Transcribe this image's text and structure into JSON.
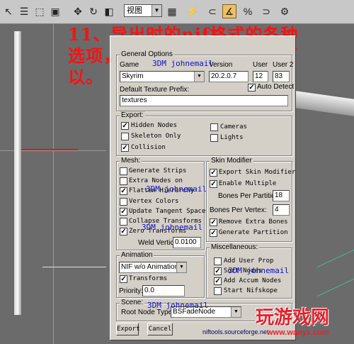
{
  "toolbar": {
    "view_value": "视图",
    "icons": [
      "select-arrow-icon",
      "select-name-icon",
      "region-rect-icon",
      "window-crossing-icon",
      "move-icon",
      "rotate-icon",
      "scale-icon",
      "pivot-icon",
      "mirror-icon",
      "snap-3d-icon",
      "angle-snap-icon",
      "percent-snap-icon",
      "spinner-snap-icon"
    ]
  },
  "overlay": {
    "line1": "11、导出时的nif格式的各种",
    "line2": "选项，按照我的这个选择就可",
    "line3": "以。"
  },
  "dialog": {
    "general": {
      "title": "General Options",
      "game_label": "Game",
      "game_value": "Skyrim",
      "version_label": "Version",
      "version_value": "20.2.0.7",
      "user_label": "User",
      "user_value": "12",
      "user2_label": "User 2",
      "user2_value": "83",
      "auto_detect_label": "Auto Detect",
      "auto_detect_checked": true,
      "texture_prefix_label": "Default Texture Prefix:",
      "texture_prefix_value": "textures"
    },
    "export": {
      "title": "Export:",
      "hidden_nodes": {
        "label": "Hidden Nodes",
        "checked": true
      },
      "skeleton_only": {
        "label": "Skeleton Only",
        "checked": false
      },
      "collision": {
        "label": "Collision",
        "checked": true
      },
      "cameras": {
        "label": "Cameras",
        "checked": false
      },
      "lights": {
        "label": "Lights",
        "checked": false
      }
    },
    "mesh": {
      "title": "Mesh:",
      "generate_strips": {
        "label": "Generate Strips",
        "checked": false
      },
      "extra_nodes": {
        "label": "Extra Nodes on",
        "checked": false
      },
      "flatten_hierarchy": {
        "label": "Flatten Hierarchy",
        "checked": true
      },
      "vertex_colors": {
        "label": "Vertex Colors",
        "checked": false
      },
      "update_tangent": {
        "label": "Update Tangent Space",
        "checked": true
      },
      "collapse_transforms": {
        "label": "Collapse Transforms",
        "checked": false
      },
      "zero_transforms": {
        "label": "Zero Transforms",
        "checked": true
      },
      "weld_label": "Weld Vertices:",
      "weld_value": "0.0100"
    },
    "skin": {
      "title": "Skin Modifier",
      "export_skin": {
        "label": "Export Skin Modifier",
        "checked": true
      },
      "enable_multiple": {
        "label": "Enable Multiple",
        "checked": true
      },
      "bones_partition_label": "Bones Per Partition:",
      "bones_partition_value": "18",
      "bones_vertex_label": "Bones Per Vertex:",
      "bones_vertex_value": "4",
      "remove_extra": {
        "label": "Remove Extra Bones",
        "checked": true
      },
      "generate_partition": {
        "label": "Generate Partition",
        "checked": true
      }
    },
    "animation": {
      "title": "Animation",
      "mode_value": "NIF w/o Animation",
      "transforms": {
        "label": "Transforms",
        "checked": true
      },
      "priority_label": "Priority:",
      "priority_value": "0.0"
    },
    "misc": {
      "title": "Miscellaneous:",
      "add_user_prop": {
        "label": "Add User Prop",
        "checked": false
      },
      "sort_nodes": {
        "label": "Sort Nodes",
        "checked": true
      },
      "add_accum": {
        "label": "Add Accum Nodes",
        "checked": true
      },
      "start_nifskope": {
        "label": "Start Nifskope",
        "checked": false
      }
    },
    "scene": {
      "title": "Scene:",
      "root_label": "Root Node Type:",
      "root_value": "BSFadeNode"
    },
    "export_button": "Export",
    "cancel_button": "Cancel",
    "link": "niftools.sourceforge.net"
  },
  "watermarks": {
    "text": "3DM johnemail"
  },
  "logo": {
    "title": "玩游戏网",
    "url": "www.wanyx.com"
  },
  "colors": {
    "overlay_red": "#ff1010",
    "watermark_blue": "#1010c0",
    "dialog_bg": "#d4d0c8"
  }
}
